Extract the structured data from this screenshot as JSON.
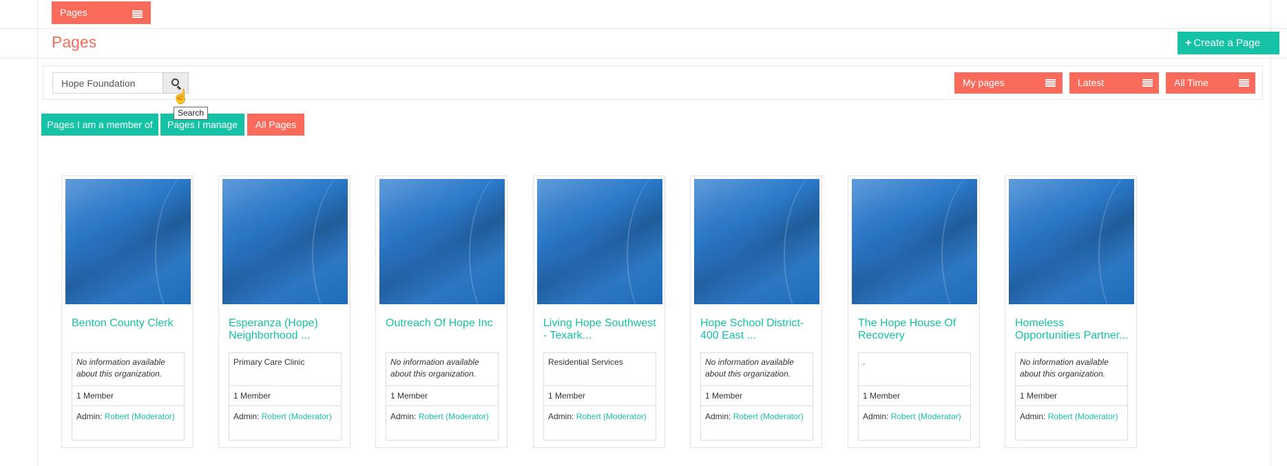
{
  "top_bar": {
    "pages_dropdown_label": "Pages"
  },
  "header": {
    "title": "Pages",
    "create_button_label": "Create a Page"
  },
  "search": {
    "value": "Hope Foundation",
    "button_tooltip": "Search"
  },
  "filters": {
    "ownership": "My pages",
    "sort": "Latest",
    "time_range": "All Time"
  },
  "tabs": [
    {
      "label": "Pages I am a member of",
      "active": false
    },
    {
      "label": "Pages I manage",
      "active": false
    },
    {
      "label": "All Pages",
      "active": true
    }
  ],
  "cards": [
    {
      "title": "Benton County Clerk",
      "description": "No information available about this organization.",
      "members": "1 Member",
      "admin_label": "Admin:",
      "admin_name": "Robert (Moderator)"
    },
    {
      "title": "Esperanza (Hope) Neighborhood ...",
      "description": "Primary Care Clinic",
      "members": "1 Member",
      "admin_label": "Admin:",
      "admin_name": "Robert (Moderator)"
    },
    {
      "title": "Outreach Of Hope Inc",
      "description": "No information available about this organization.",
      "members": "1 Member",
      "admin_label": "Admin:",
      "admin_name": "Robert (Moderator)"
    },
    {
      "title": "Living Hope Southwest - Texark...",
      "description": "Residential Services",
      "members": "1 Member",
      "admin_label": "Admin:",
      "admin_name": "Robert (Moderator)"
    },
    {
      "title": "Hope School District-400 East ...",
      "description": "No information available about this organization.",
      "members": "1 Member",
      "admin_label": "Admin:",
      "admin_name": "Robert (Moderator)"
    },
    {
      "title": "The Hope House Of Recovery",
      "description": ".",
      "members": "1 Member",
      "admin_label": "Admin:",
      "admin_name": "Robert (Moderator)"
    },
    {
      "title": "Homeless Opportunities Partner...",
      "description": "No information available about this organization.",
      "members": "1 Member",
      "admin_label": "Admin:",
      "admin_name": "Robert (Moderator)"
    }
  ],
  "colors": {
    "accent_coral": "#fa6b5c",
    "accent_teal": "#16c2a5"
  },
  "icons": {
    "menu": "hamburger-icon",
    "search": "search-icon",
    "create": "plus-icon"
  }
}
